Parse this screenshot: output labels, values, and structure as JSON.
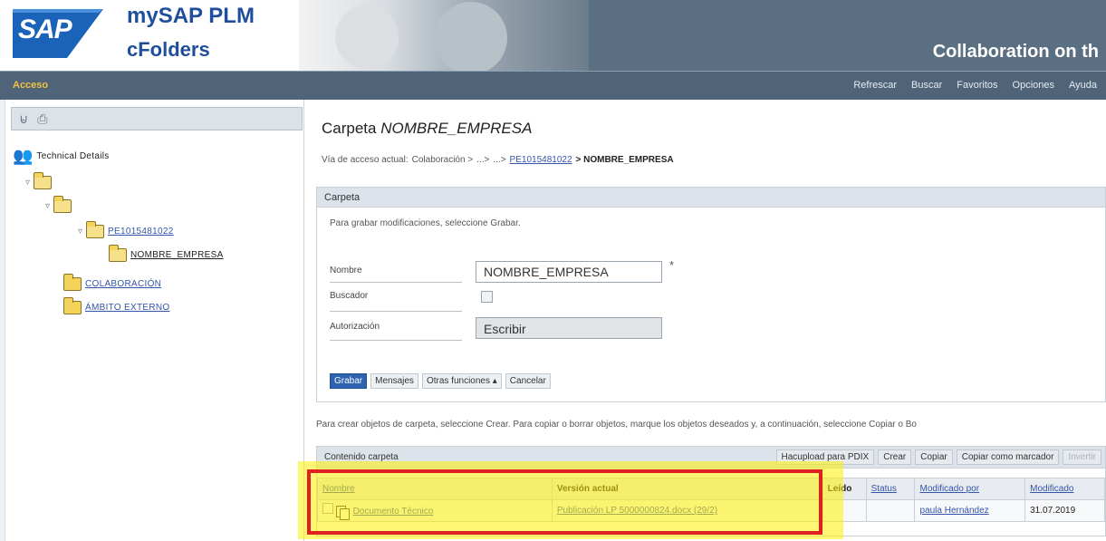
{
  "header": {
    "logo_text": "SAP",
    "brand_title": "mySAP PLM",
    "brand_sub": "cFolders",
    "slogan": "Collaboration on th"
  },
  "nav": {
    "acceso": "Acceso",
    "links": [
      "Refrescar",
      "Buscar",
      "Favoritos",
      "Opciones",
      "Ayuda"
    ]
  },
  "sidebar": {
    "root_label": "Technical Details",
    "node_pe": "PE1015481022",
    "node_current": "NOMBRE_EMPRESA",
    "node_colab": "COLABORACIÓN",
    "node_ambito": "ÁMBITO EXTERNO"
  },
  "main": {
    "title_prefix": "Carpeta ",
    "title_name": "NOMBRE_EMPRESA",
    "breadcrumb": {
      "label": "Vía de acceso actual:",
      "colaboracion": "Colaboración >",
      "dots1": "...>",
      "dots2": "...>",
      "link": "PE1015481022",
      "current": "> NOMBRE_EMPRESA"
    },
    "folder_panel": {
      "header": "Carpeta",
      "hint": "Para grabar modificaciones, seleccione Grabar.",
      "name_label": "Nombre",
      "name_value": "NOMBRE_EMPRESA",
      "required": "*",
      "buscar_label": "Buscador",
      "auth_label": "Autorización",
      "auth_value": "Escribir",
      "buttons": {
        "grabar": "Grabar",
        "mensajes": "Mensajes",
        "otras": "Otras funciones ▴",
        "cancelar": "Cancelar"
      }
    },
    "create_hint": "Para crear objetos de carpeta, seleccione Crear. Para copiar o borrar objetos, marque los objetos deseados y, a continuación, seleccione Copiar o Bo",
    "contents": {
      "title": "Contenido carpeta",
      "actions": {
        "upload": "Hacupload para PDIX",
        "crear": "Crear",
        "copiar": "Copiar",
        "copiar_marcador": "Copiar como marcador",
        "invertir": "Invertir"
      },
      "columns": {
        "nombre": "Nombre",
        "version": "Versión actual",
        "leido": "Leído",
        "status": "Status",
        "modificado_por": "Modificado por",
        "modificado": "Modificado"
      },
      "row": {
        "nombre": "Documento Técnico",
        "version": "Publicación LP 5000000824.docx (29/2)",
        "leido": "",
        "status": "",
        "modificado_por": "paula Hernández",
        "modificado": "31.07.2019"
      }
    }
  },
  "colors": {
    "header_bg": "#5b6f82",
    "nav_bg": "#4f6478",
    "accent_gold": "#f3c142",
    "link_blue": "#3355aa",
    "highlight_yellow": "#fff000",
    "highlight_red": "#e02020"
  }
}
